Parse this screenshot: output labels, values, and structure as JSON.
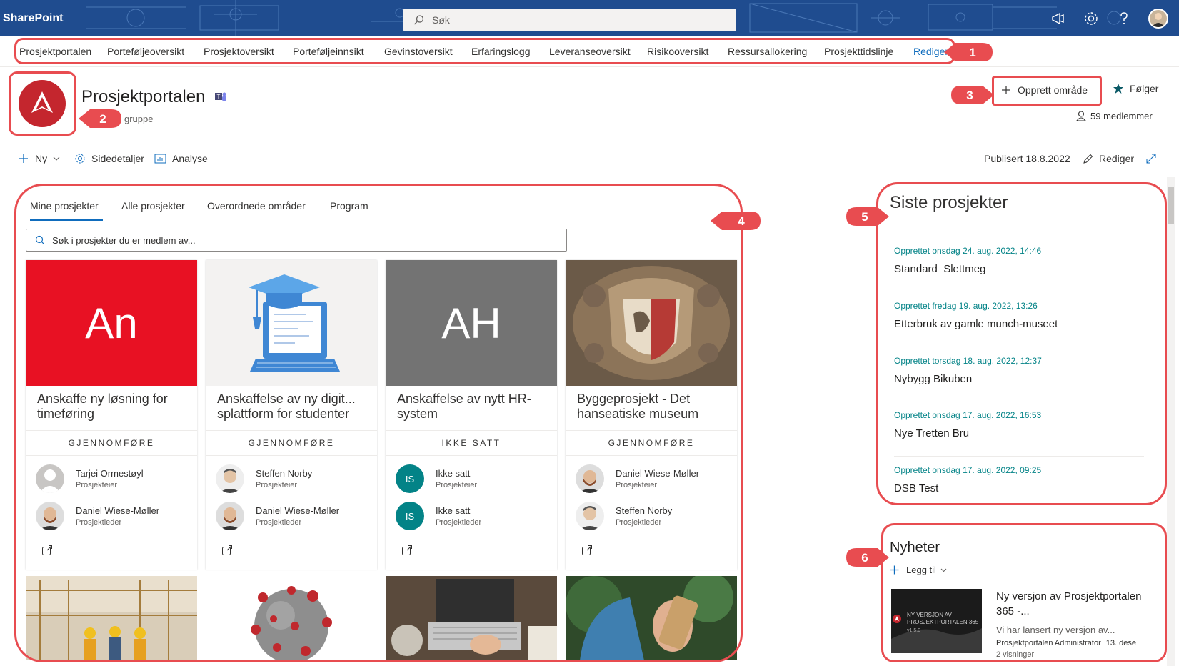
{
  "suitebar": {
    "brand": "SharePoint",
    "search_placeholder": "Søk",
    "bg_color": "#1f4c8f"
  },
  "topnav": {
    "items": [
      "Prosjektportalen",
      "Porteføljeoversikt",
      "Prosjektoversikt",
      "Porteføljeinnsikt",
      "Gevinstoversikt",
      "Erfaringslogg",
      "Leveranseoversikt",
      "Risikooversikt",
      "Ressursallokering",
      "Prosjekttidslinje"
    ],
    "edit_label": "Rediger"
  },
  "header": {
    "title": "Prosjektportalen",
    "subtitle": "gruppe",
    "create_label": "Opprett område",
    "follow_label": "Følger",
    "members_label": "59 medlemmer",
    "logo_color": "#c4262e"
  },
  "commandbar": {
    "new_label": "Ny",
    "details_label": "Sidedetaljer",
    "analytics_label": "Analyse",
    "published_label": "Publisert 18.8.2022",
    "edit_label": "Rediger"
  },
  "projects": {
    "tabs": [
      "Mine prosjekter",
      "Alle prosjekter",
      "Overordnede områder",
      "Program"
    ],
    "search_placeholder": "Søk i prosjekter du er medlem av...",
    "cards": [
      {
        "title": "Anskaffe ny løsning for timeføring",
        "tile_text": "An",
        "tile_color": "#e81123",
        "phase": "GJENNOMFØRE",
        "people": [
          {
            "name": "Tarjei Ormestøyl",
            "role": "Prosjekteier"
          },
          {
            "name": "Daniel Wiese-Møller",
            "role": "Prosjektleder"
          }
        ]
      },
      {
        "title": "Anskaffelse av ny digit... splattform for studenter",
        "tile_text": "",
        "tile_color": "#f3f2f1",
        "phase": "GJENNOMFØRE",
        "people": [
          {
            "name": "Steffen Norby",
            "role": "Prosjekteier"
          },
          {
            "name": "Daniel Wiese-Møller",
            "role": "Prosjektleder"
          }
        ]
      },
      {
        "title": "Anskaffelse av nytt HR-system",
        "tile_text": "AH",
        "tile_color": "#737373",
        "phase": "IKKE SATT",
        "people": [
          {
            "name": "Ikke satt",
            "role": "Prosjekteier",
            "initials": "IS"
          },
          {
            "name": "Ikke satt",
            "role": "Prosjektleder",
            "initials": "IS"
          }
        ]
      },
      {
        "title": "Byggeprosjekt - Det hanseatiske museum",
        "tile_text": "",
        "tile_color": "#6b5a48",
        "phase": "GJENNOMFØRE",
        "people": [
          {
            "name": "Daniel Wiese-Møller",
            "role": "Prosjekteier"
          },
          {
            "name": "Steffen Norby",
            "role": "Prosjektleder"
          }
        ]
      }
    ]
  },
  "recent": {
    "title": "Siste prosjekter",
    "items": [
      {
        "date": "Opprettet onsdag 24. aug. 2022, 14:46",
        "name": "Standard_Slettmeg"
      },
      {
        "date": "Opprettet fredag 19. aug. 2022, 13:26",
        "name": "Etterbruk av gamle munch-museet"
      },
      {
        "date": "Opprettet torsdag 18. aug. 2022, 12:37",
        "name": "Nybygg Bikuben"
      },
      {
        "date": "Opprettet onsdag 17. aug. 2022, 16:53",
        "name": "Nye Tretten Bru"
      },
      {
        "date": "Opprettet onsdag 17. aug. 2022, 09:25",
        "name": "DSB Test"
      }
    ]
  },
  "news": {
    "title": "Nyheter",
    "add_label": "Legg til",
    "item_title": "Ny versjon av Prosjektportalen 365 -...",
    "item_desc": "Vi har lansert ny versjon av...",
    "item_author": "Prosjektportalen Administrator",
    "item_date": "13. dese",
    "item_views": "2 visninger",
    "thumb_text": "NY VERSJON AV PROSJEKTPORTALEN 365",
    "thumb_version": "v1.5.0"
  },
  "annotations": [
    "1",
    "2",
    "3",
    "4",
    "5",
    "6"
  ]
}
